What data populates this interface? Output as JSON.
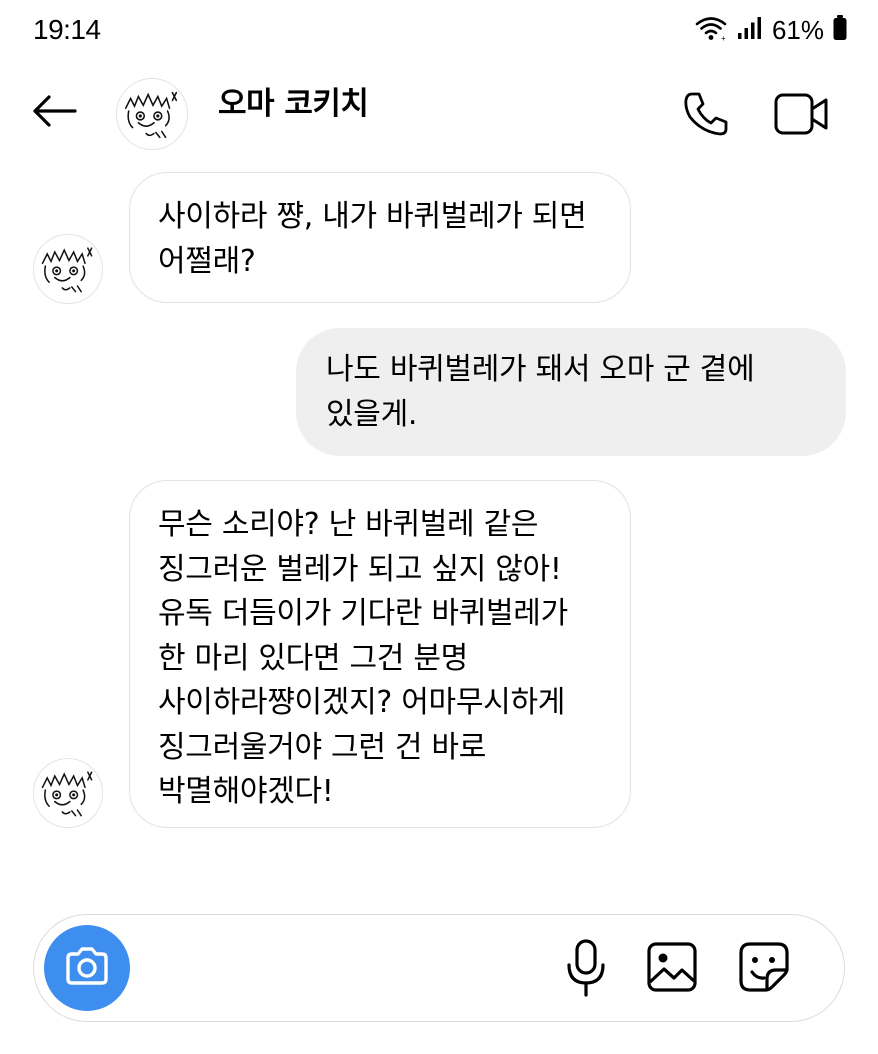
{
  "status_bar": {
    "time": "19:14",
    "battery_percent": "61%",
    "icons": [
      "wifi-icon",
      "signal-icon",
      "battery-icon"
    ]
  },
  "header": {
    "back_icon": "arrow-left-icon",
    "contact_name": "오마 코키치",
    "call_icon": "phone-icon",
    "video_icon": "video-camera-icon"
  },
  "messages": [
    {
      "direction": "incoming",
      "text": "사이하라 쨩, 내가 바퀴벌레가 되면 어쩔래?"
    },
    {
      "direction": "outgoing",
      "text": "나도 바퀴벌레가 돼서 오마 군 곁에 있을게."
    },
    {
      "direction": "incoming",
      "text": "무슨 소리야? 난 바퀴벌레 같은 징그러운 벌레가 되고 싶지 않아! 유독 더듬이가 기다란 바퀴벌레가 한 마리 있다면 그건 분명 사이하라쨩이겠지? 어마무시하게 징그러울거야 그런 건 바로 박멸해야겠다!"
    }
  ],
  "composer": {
    "placeholder": "",
    "camera_icon": "camera-icon",
    "mic_icon": "microphone-icon",
    "gallery_icon": "image-icon",
    "sticker_icon": "sticker-icon"
  },
  "colors": {
    "camera_button": "#3e8ef0",
    "outgoing_bubble": "#efefef",
    "incoming_bubble_border": "#e2e2e2"
  }
}
